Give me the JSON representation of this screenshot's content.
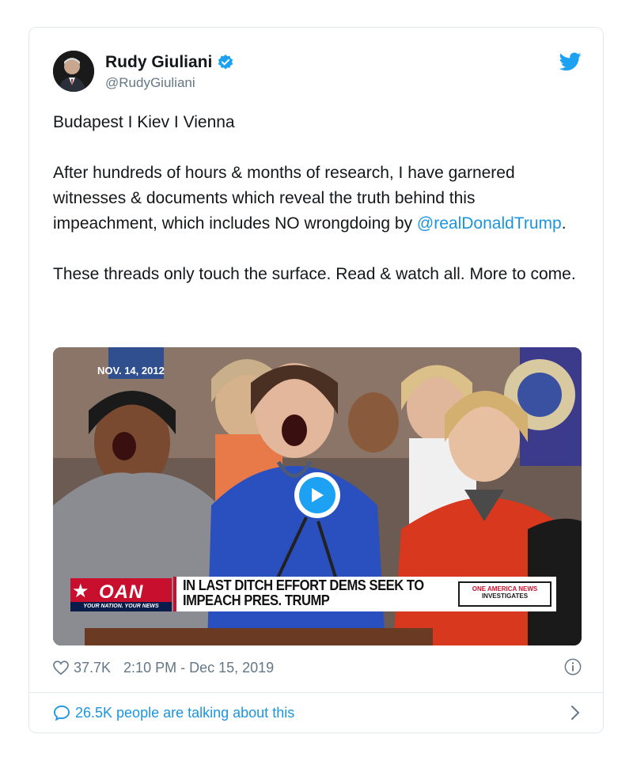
{
  "tweet": {
    "author_name": "Rudy Giuliani",
    "handle": "@RudyGiuliani",
    "paragraphs": {
      "p1": "Budapest I Kiev I Vienna",
      "p2_before": "After hundreds of hours & months of research, I have garnered witnesses & documents which reveal the truth behind this impeachment, which includes NO wrongdoing by ",
      "p2_mention": "@realDonaldTrump",
      "p2_after": ".",
      "p3": "These threads only touch the surface. Read & watch all. More to come."
    },
    "likes": "37.7K",
    "timestamp": "2:10 PM - Dec 15, 2019",
    "talking": "26.5K people are talking about this"
  },
  "video": {
    "date_stamp": "NOV. 14, 2012",
    "network_logo": "OAN",
    "network_tagline": "YOUR NATION. YOUR NEWS",
    "headline_line1": "IN LAST DITCH EFFORT DEMS SEEK TO",
    "headline_line2": "IMPEACH PRES. TRUMP",
    "program_line1": "ONE AMERICA NEWS",
    "program_line2": "INVESTIGATES"
  },
  "colors": {
    "accent": "#1da1f2",
    "link": "#1b95e0",
    "muted": "#657786",
    "border": "#e1e8ed"
  },
  "icons": [
    "verified-badge-icon",
    "twitter-bird-icon",
    "play-icon",
    "heart-icon",
    "info-icon",
    "reply-bubble-icon",
    "chevron-right-icon"
  ]
}
